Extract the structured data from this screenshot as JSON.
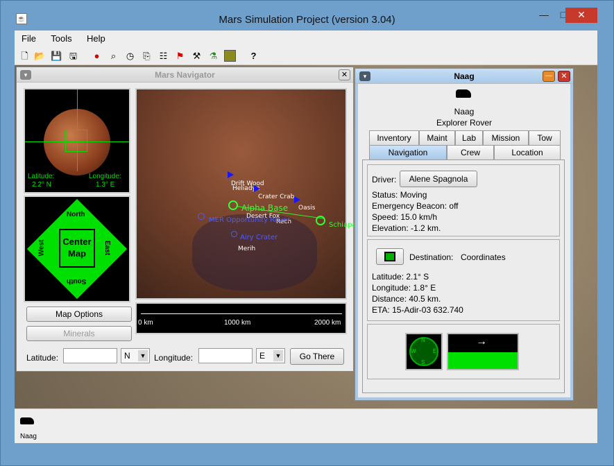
{
  "window": {
    "title": "Mars Simulation Project (version 3.04)",
    "minimize": "—",
    "maximize": "□",
    "close": "✕"
  },
  "menu": [
    "File",
    "Tools",
    "Help"
  ],
  "toolbar": {
    "help_glyph": "?"
  },
  "navigator": {
    "title": "Mars Navigator",
    "latitude_label": "Latitude:",
    "latitude_value": "2.2° N",
    "longitude_label": "Longitude:",
    "longitude_value": "1.3° E",
    "compass": {
      "north": "North",
      "south": "South",
      "east": "East",
      "west": "West",
      "center_line1": "Center",
      "center_line2": "Map"
    },
    "map_options_label": "Map Options",
    "minerals_label": "Minerals",
    "scale": {
      "left": "0 km",
      "mid": "1000 km",
      "right": "2000 km"
    },
    "lat_input_label": "Latitude:",
    "lat_dir": "N",
    "lon_input_label": "Longitude:",
    "lon_dir": "E",
    "go_there_label": "Go There",
    "map_labels": [
      "Drift Wood",
      "Heliadyn",
      "Crater Crab",
      "Alpha Base",
      "Oasis",
      "Desert Fox",
      "Rech",
      "MER Opportunity Rover",
      "Airy Crater",
      "Merih",
      "Schiaparelli"
    ]
  },
  "vehicle": {
    "title": "Naag",
    "name": "Naag",
    "type": "Explorer Rover",
    "tabs_row1": [
      "Inventory",
      "Maint",
      "Lab",
      "Mission",
      "Tow"
    ],
    "tabs_row2": [
      "Navigation",
      "Crew",
      "Location"
    ],
    "selected_tab": "Navigation",
    "driver_label": "Driver:",
    "driver_name": "Alene Spagnola",
    "status": "Status: Moving",
    "beacon": "Emergency Beacon: off",
    "speed": "Speed: 15.0 km/h",
    "elevation": "Elevation: -1.2 km.",
    "destination_label": "Destination:",
    "destination_value": "Coordinates",
    "dest_latitude": "Latitude: 2.1° S",
    "dest_longitude": "Longitude: 1.8° E",
    "distance": "Distance: 40.5 km.",
    "eta": "ETA: 15-Adir-03  632.740",
    "compass_letters": {
      "n": "N",
      "s": "S",
      "e": "E",
      "w": "W"
    }
  },
  "taskbar": {
    "item_label": "Naag"
  },
  "colors": {
    "accent_green": "#00e000",
    "frame_blue": "#a7c9ea",
    "title_bg": "#6fa0cc"
  }
}
